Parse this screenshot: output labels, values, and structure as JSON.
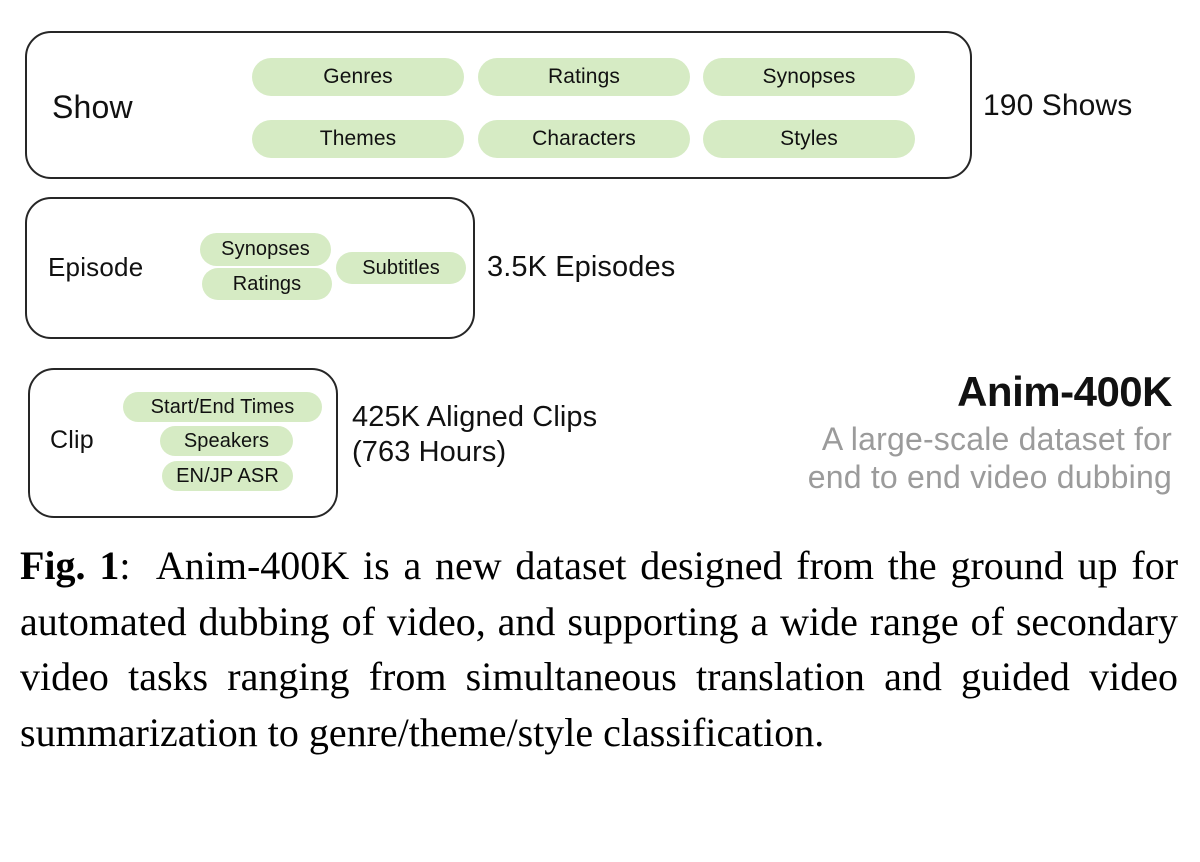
{
  "figure": {
    "levels": [
      {
        "name": "show",
        "label": "Show",
        "count": "190 Shows",
        "pills": [
          "Genres",
          "Ratings",
          "Synopses",
          "Themes",
          "Characters",
          "Styles"
        ]
      },
      {
        "name": "episode",
        "label": "Episode",
        "count": "3.5K Episodes",
        "pills": [
          "Synopses",
          "Ratings",
          "Subtitles"
        ]
      },
      {
        "name": "clip",
        "label": "Clip",
        "count": "425K Aligned Clips\n(763 Hours)",
        "pills": [
          "Start/End Times",
          "Speakers",
          "EN/JP ASR"
        ]
      }
    ],
    "brand": {
      "title": "Anim-400K",
      "subtitle": "A large-scale dataset for\nend to end video dubbing"
    },
    "colors": {
      "pill_fill": "#d6ebc4",
      "box_border": "#262626",
      "subtitle_gray": "#9b9b9b",
      "text": "#111111"
    }
  },
  "caption": {
    "label": "Fig. 1",
    "separator": ":",
    "body": "Anim-400K is a new dataset designed from the ground up for automated dubbing of video, and supporting a wide range of secondary video tasks ranging from simultaneous translation and guided video summarization to genre/theme/style classification."
  }
}
